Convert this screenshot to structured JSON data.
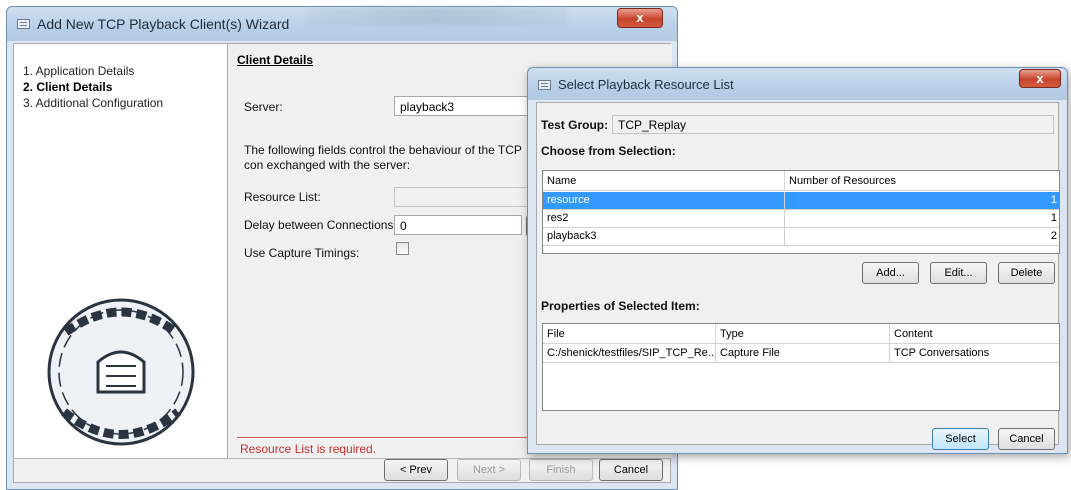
{
  "wizard": {
    "title": "Add New TCP Playback Client(s) Wizard",
    "close_label": "x",
    "steps": [
      "1. Application Details",
      "2. Client Details",
      "3. Additional Configuration"
    ],
    "section_title": "Client Details",
    "server_label": "Server:",
    "server_value": "playback3",
    "info_text": "The following fields control the behaviour of the TCP con exchanged with the server:",
    "resource_list_label": "Resource List:",
    "resource_list_value": "",
    "delay_label": "Delay between Connections:",
    "delay_value": "0",
    "capture_timings_label": "Use Capture Timings:",
    "capture_timings_checked": false,
    "error_text": "Resource List is required.",
    "buttons": {
      "prev": "< Prev",
      "next": "Next >",
      "finish": "Finish",
      "cancel": "Cancel"
    }
  },
  "dialog": {
    "title": "Select Playback Resource List",
    "close_label": "x",
    "test_group_label": "Test Group:",
    "test_group_value": "TCP_Replay",
    "choose_label": "Choose from Selection:",
    "resource_table": {
      "columns": [
        "Name",
        "Number of Resources"
      ],
      "rows": [
        {
          "name": "resource",
          "count": "1",
          "selected": true
        },
        {
          "name": "res2",
          "count": "1",
          "selected": false
        },
        {
          "name": "playback3",
          "count": "2",
          "selected": false
        }
      ]
    },
    "buttons": {
      "add": "Add...",
      "edit": "Edit...",
      "delete": "Delete",
      "select": "Select",
      "cancel": "Cancel"
    },
    "properties_label": "Properties of Selected Item:",
    "properties_table": {
      "columns": [
        "File",
        "Type",
        "Content"
      ],
      "rows": [
        {
          "file": "C:/shenick/testfiles/SIP_TCP_Re...",
          "type": "Capture File",
          "content": "TCP Conversations"
        }
      ]
    }
  },
  "colors": {
    "selection": "#3399ff",
    "error": "#c62f2f",
    "title_bar": "#b9cfe8"
  }
}
